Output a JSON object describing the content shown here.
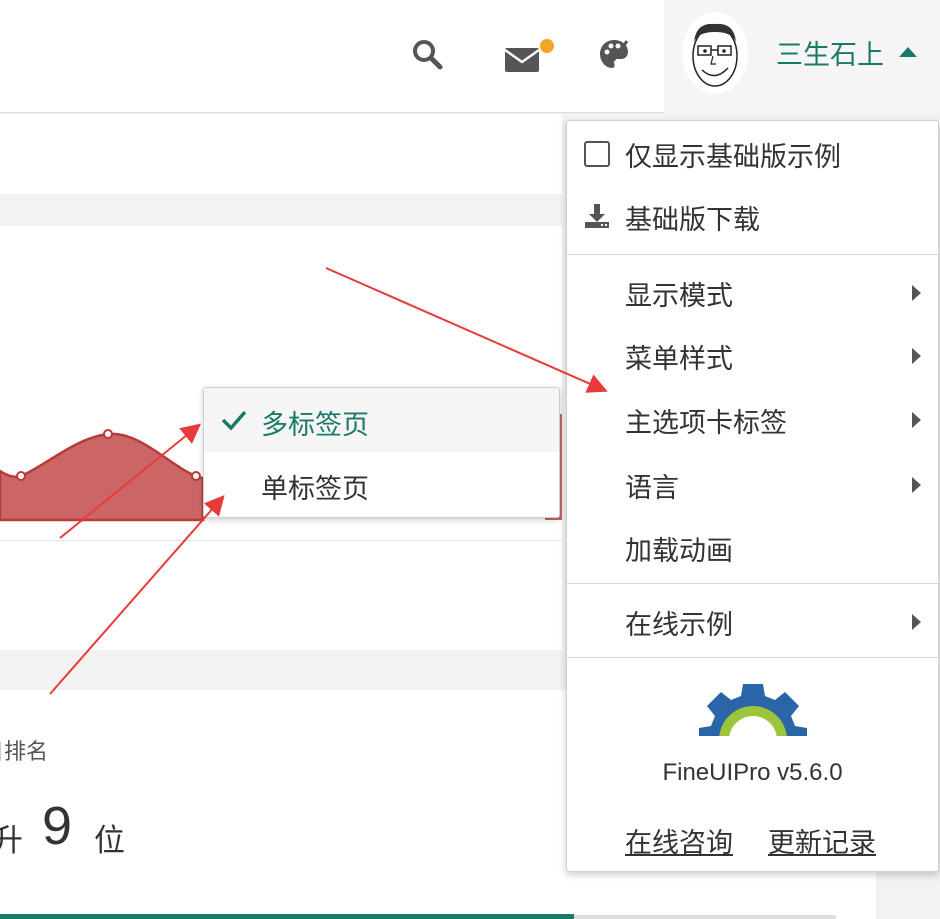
{
  "header": {
    "user_name": "三生石上",
    "icons": [
      "search-icon",
      "mail-icon",
      "theme-icon"
    ],
    "mail_badge_color": "#f4a522",
    "accent_color": "#1a7a6a"
  },
  "background": {
    "rank_label": "日排名",
    "rank_prefix": "升",
    "rank_value": "9",
    "rank_suffix": "位",
    "chart_fill_color": "#cc6666"
  },
  "tab_submenu": {
    "items": [
      {
        "label": "多标签页",
        "checked": true
      },
      {
        "label": "单标签页",
        "checked": false
      }
    ]
  },
  "menu": {
    "show_basic_only": "仅显示基础版示例",
    "basic_download": "基础版下载",
    "display_mode": "显示模式",
    "menu_style": "菜单样式",
    "main_tab_label": "主选项卡标签",
    "language": "语言",
    "loading_animation": "加载动画",
    "online_examples": "在线示例",
    "version": "FineUIPro v5.6.0",
    "consult_link": "在线咨询",
    "changelog_link": "更新记录"
  }
}
